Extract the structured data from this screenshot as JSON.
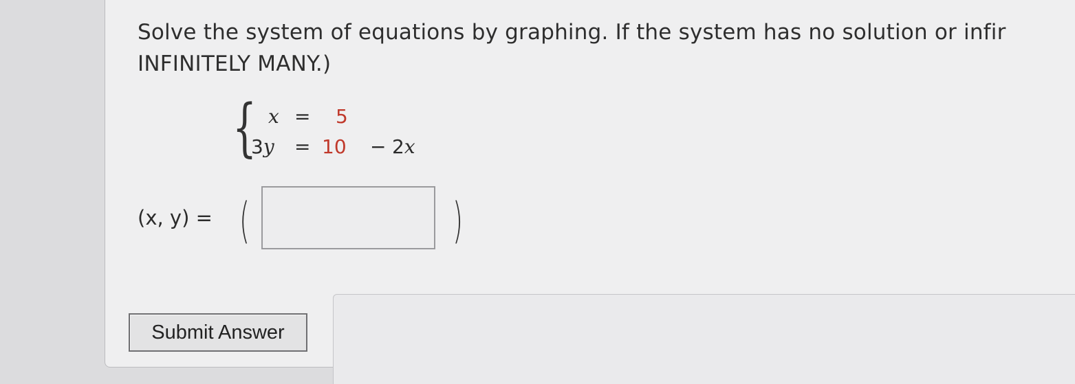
{
  "question": {
    "line1": "Solve the system of equations by graphing. If the system has no solution or infir",
    "line2": "INFINITELY MANY.)"
  },
  "system": {
    "eq1": {
      "lhs_var": "x",
      "equals": "=",
      "rhs_const": "5"
    },
    "eq2": {
      "lhs_coef": "3",
      "lhs_var": "y",
      "equals": "=",
      "rhs_const": "10",
      "minus": "−",
      "rhs_term": "2",
      "rhs_var": "x"
    },
    "constant_color": "#c0392b"
  },
  "answer": {
    "label": "(x, y) =",
    "open_paren": "(",
    "close_paren": ")",
    "value": ""
  },
  "submit": {
    "label": "Submit Answer"
  }
}
